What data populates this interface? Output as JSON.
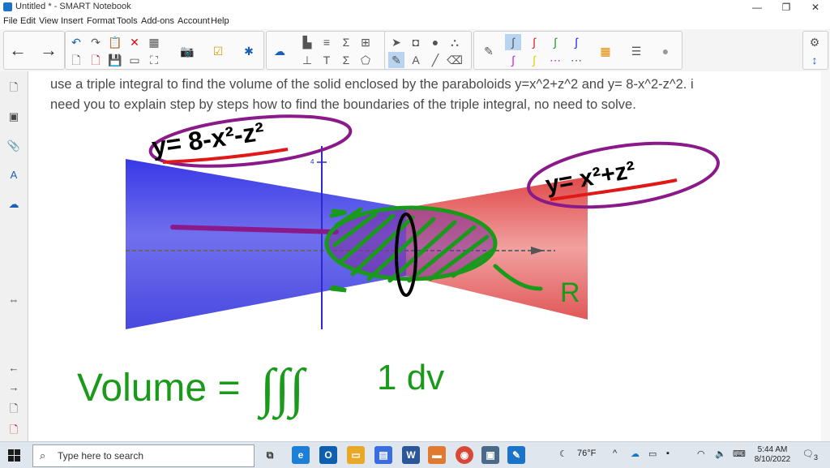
{
  "window": {
    "title": "Untitled * - SMART Notebook",
    "minimize": "—",
    "restore": "❐",
    "close": "✕"
  },
  "menu": [
    "File",
    "Edit",
    "View",
    "Insert",
    "Format",
    "Tools",
    "Add-ons",
    "Account",
    "Help"
  ],
  "question": {
    "line1": "use a triple integral to find the volume of the solid enclosed by the paraboloids y=x^2+z^2 and y= 8-x^2-z^2. i",
    "line2": "need you to explain step by steps how to find the boundaries of the triple integral, no need to solve."
  },
  "graph": {
    "tick_label": "4"
  },
  "annotations": {
    "upper_surface": "y= 8-x²-z²",
    "lower_surface": "y= x²+z²",
    "region": "R",
    "volume_lhs": "Volume =",
    "volume_integrand": "1 dv"
  },
  "colors": {
    "ink_green": "#1a9a1a",
    "ink_purple": "#8a1a8a",
    "ink_red": "#e01818",
    "paraboloid_top": "#3a3ae0",
    "paraboloid_bottom": "#e04848"
  },
  "taskbar": {
    "search_placeholder": "Type here to search",
    "weather": "76°F",
    "time": "5:44 AM",
    "date": "8/10/2022",
    "notifications": "3"
  }
}
